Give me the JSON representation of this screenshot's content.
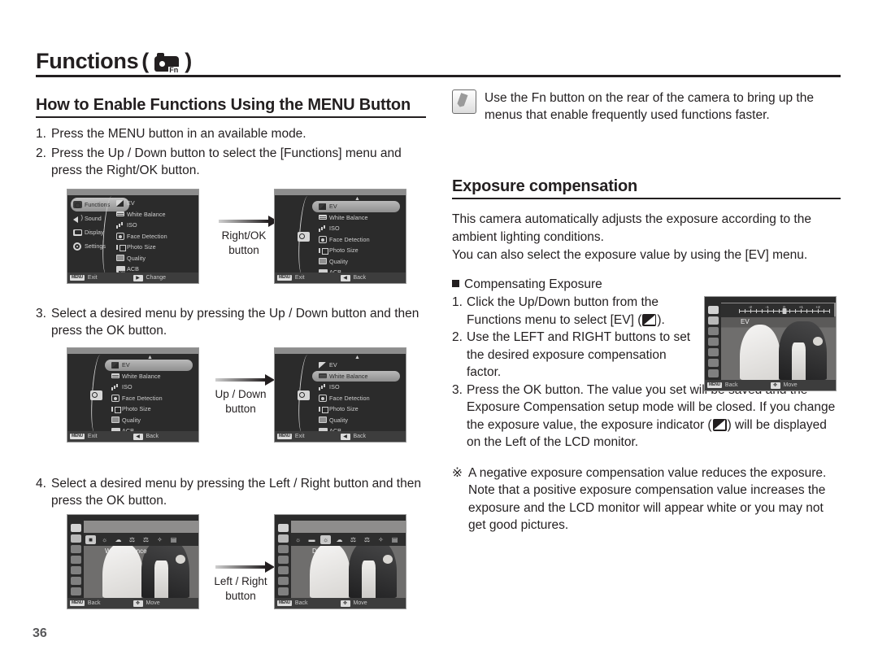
{
  "page": {
    "number": "36",
    "title": "Functions",
    "title_icon": "camera-fn-icon",
    "paren_open": "(",
    "paren_close": ")"
  },
  "left": {
    "heading": "How to Enable Functions Using the MENU Button",
    "steps": [
      {
        "num": "1.",
        "text": "Press the MENU button in an available mode."
      },
      {
        "num": "2.",
        "text": "Press the Up / Down button to select the [Functions] menu and press the Right/OK button."
      },
      {
        "num": "3.",
        "text": "Select a desired menu by pressing the Up / Down button and then press the OK button."
      },
      {
        "num": "4.",
        "text": "Select a desired menu by pressing the Left / Right button and then press the OK button."
      }
    ],
    "arrows": [
      {
        "label_line1": "Right/OK",
        "label_line2": "button"
      },
      {
        "label_line1": "Up / Down",
        "label_line2": "button"
      },
      {
        "label_line1": "Left / Right",
        "label_line2": "button"
      }
    ]
  },
  "right": {
    "note": "Use the Fn button on the rear of the camera to bring up the menus that enable frequently used functions faster.",
    "heading": "Exposure compensation",
    "intro": [
      "This camera automatically adjusts the exposure according to the ambient lighting conditions.",
      "You can also select the exposure value by using the [EV] menu."
    ],
    "sub_heading": "Compensating Exposure",
    "sub_steps": [
      {
        "num": "1.",
        "pre": "Click the Up/Down button from the Functions menu to select [EV] (",
        "post": ")."
      },
      {
        "num": "2.",
        "pre": "Use the LEFT and RIGHT buttons to set the desired exposure compensation factor.",
        "post": ""
      },
      {
        "num": "3.",
        "pre": "Press the OK button. The value you set will be saved and the Exposure Compensation setup mode will be closed. If you change the exposure value, the exposure indicator (",
        "post": ") will be displayed on the Left of the LCD monitor."
      }
    ],
    "footnote_mark": "※",
    "footnote": "A negative exposure compensation value reduces the exposure. Note that a positive exposure compensation value increases the exposure and the LCD monitor will appear white or you may not get good pictures."
  },
  "lcd": {
    "menu_left": [
      {
        "label": "Functions",
        "icon": "camera-fn-icon"
      },
      {
        "label": "Sound",
        "icon": "speaker-icon"
      },
      {
        "label": "Display",
        "icon": "display-icon"
      },
      {
        "label": "Settings",
        "icon": "gear-icon"
      }
    ],
    "menu_right": [
      {
        "label": "EV",
        "icon": "ev-icon"
      },
      {
        "label": "White Balance",
        "icon": "white-balance-icon"
      },
      {
        "label": "ISO",
        "icon": "iso-icon"
      },
      {
        "label": "Face Detection",
        "icon": "face-detection-icon"
      },
      {
        "label": "Photo Size",
        "icon": "photo-size-icon"
      },
      {
        "label": "Quality",
        "icon": "quality-icon"
      },
      {
        "label": "ACB",
        "icon": "acb-icon"
      }
    ],
    "bottom": {
      "menu_key": "MENU",
      "exit": "Exit",
      "change": "Change",
      "back": "Back",
      "move": "Move"
    },
    "screens": {
      "s1_selected_left": "Functions",
      "s2_selected_right": "EV",
      "s3_selected_right": "EV",
      "s4_selected_right": "White Balance",
      "s5_option_label": "White Balance",
      "s6_option_label": "Daylight",
      "s7_option_label": "EV"
    },
    "wb_options": [
      "auto",
      "daylight",
      "cloudy",
      "fluorescent-h",
      "fluorescent-l",
      "tungsten",
      "custom"
    ],
    "ev_scale": {
      "labels": [
        "-2",
        "-1",
        "0",
        "+1",
        "+2"
      ],
      "min": -2,
      "max": 2,
      "current": 0
    }
  }
}
